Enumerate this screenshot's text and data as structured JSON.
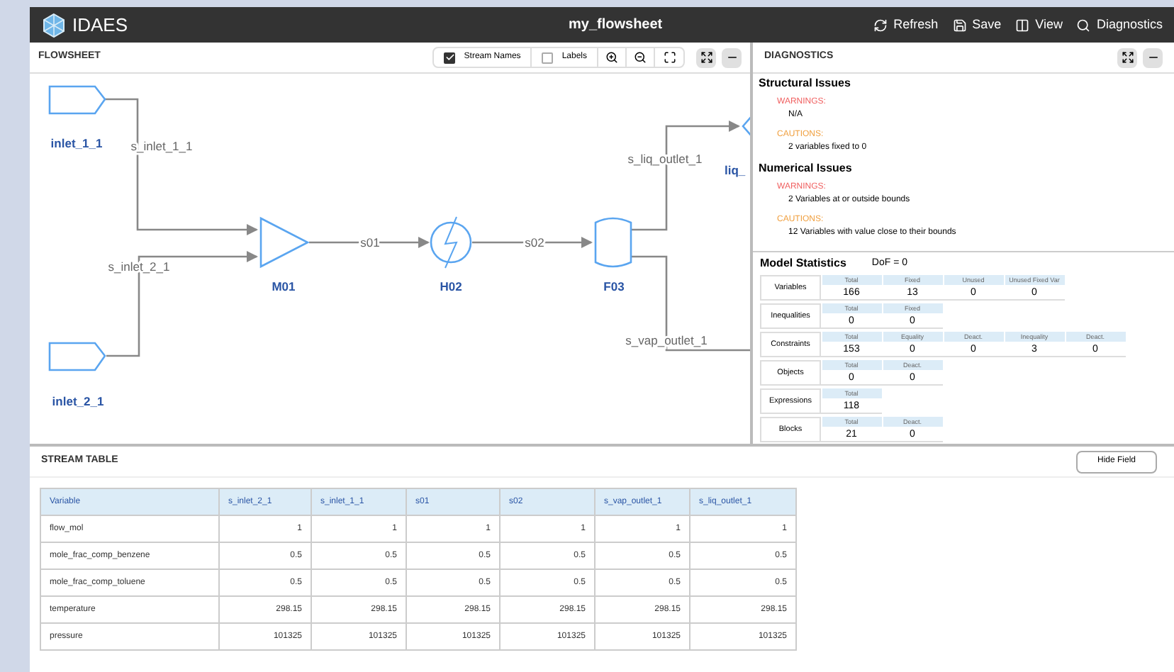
{
  "header": {
    "logo": "IDAES",
    "title": "my_flowsheet",
    "actions": [
      {
        "kind": "refresh",
        "label": "Refresh"
      },
      {
        "kind": "save",
        "label": "Save"
      },
      {
        "kind": "view",
        "label": "View"
      },
      {
        "kind": "search",
        "label": "Diagnostics"
      }
    ]
  },
  "flowsheet": {
    "title": "FLOWSHEET",
    "toggles": [
      {
        "label": "Stream Names",
        "checked": true
      },
      {
        "label": "Labels",
        "checked": false
      }
    ],
    "nodes": [
      {
        "kind": "feed",
        "label": "inlet_1_1"
      },
      {
        "kind": "feed",
        "label": "inlet_2_1"
      },
      {
        "kind": "mixer",
        "label": "M01"
      },
      {
        "kind": "heater",
        "label": "H02"
      },
      {
        "kind": "flash",
        "label": "F03"
      },
      {
        "kind": "product",
        "label": "liq_"
      }
    ],
    "streams": [
      {
        "label": "s_inlet_1_1"
      },
      {
        "label": "s_inlet_2_1"
      },
      {
        "label": "s01"
      },
      {
        "label": "s02"
      },
      {
        "label": "s_liq_outlet_1"
      },
      {
        "label": "s_vap_outlet_1"
      }
    ]
  },
  "diagnostics": {
    "title": "DIAGNOSTICS",
    "sections": [
      {
        "title": "Structural Issues",
        "groups": [
          {
            "kind": "warning",
            "label": "WARNINGS:",
            "items": [
              "N/A"
            ]
          },
          {
            "kind": "caution",
            "label": "CAUTIONS:",
            "items": [
              "2 variables fixed to 0"
            ]
          }
        ]
      },
      {
        "title": "Numerical Issues",
        "groups": [
          {
            "kind": "warning",
            "label": "WARNINGS:",
            "items": [
              "2 Variables at or outside bounds"
            ]
          },
          {
            "kind": "caution",
            "label": "CAUTIONS:",
            "items": [
              "12 Variables with value close to their bounds"
            ]
          }
        ]
      }
    ],
    "stats_title": "Model Statistics",
    "dof": "DoF = 0",
    "stats": [
      {
        "label": "Variables",
        "cells": [
          {
            "head": "Total",
            "value": "166"
          },
          {
            "head": "Fixed",
            "value": "13"
          },
          {
            "head": "Unused",
            "value": "0"
          },
          {
            "head": "Unused Fixed Var",
            "value": "0"
          }
        ]
      },
      {
        "label": "Inequalities",
        "cells": [
          {
            "head": "Total",
            "value": "0"
          },
          {
            "head": "Fixed",
            "value": "0"
          }
        ]
      },
      {
        "label": "Constraints",
        "cells": [
          {
            "head": "Total",
            "value": "153"
          },
          {
            "head": "Equality",
            "value": "0"
          },
          {
            "head": "Deact.",
            "value": "0"
          },
          {
            "head": "Inequality",
            "value": "3"
          },
          {
            "head": "Deact.",
            "value": "0"
          }
        ]
      },
      {
        "label": "Objects",
        "cells": [
          {
            "head": "Total",
            "value": "0"
          },
          {
            "head": "Deact.",
            "value": "0"
          }
        ]
      },
      {
        "label": "Expressions",
        "cells": [
          {
            "head": "Total",
            "value": "118"
          }
        ]
      },
      {
        "label": "Blocks",
        "cells": [
          {
            "head": "Total",
            "value": "21"
          },
          {
            "head": "Deact.",
            "value": "0"
          }
        ]
      }
    ]
  },
  "stream_table": {
    "title": "STREAM TABLE",
    "hide_button": "Hide Field",
    "columns": [
      "Variable",
      "s_inlet_2_1",
      "s_inlet_1_1",
      "s01",
      "s02",
      "s_vap_outlet_1",
      "s_liq_outlet_1"
    ],
    "rows": [
      [
        "flow_mol",
        "1",
        "1",
        "1",
        "1",
        "1",
        "1"
      ],
      [
        "mole_frac_comp_benzene",
        "0.5",
        "0.5",
        "0.5",
        "0.5",
        "0.5",
        "0.5"
      ],
      [
        "mole_frac_comp_toluene",
        "0.5",
        "0.5",
        "0.5",
        "0.5",
        "0.5",
        "0.5"
      ],
      [
        "temperature",
        "298.15",
        "298.15",
        "298.15",
        "298.15",
        "298.15",
        "298.15"
      ],
      [
        "pressure",
        "101325",
        "101325",
        "101325",
        "101325",
        "101325",
        "101325"
      ]
    ]
  }
}
